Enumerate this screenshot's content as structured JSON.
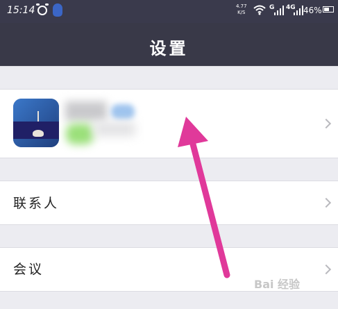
{
  "status_bar": {
    "time": "15:14",
    "net_speed": "4.77\nK/S",
    "battery": "46%",
    "signal_labels": [
      "G",
      "4G"
    ],
    "icons": [
      "alarm-icon",
      "qq-icon",
      "wifi-icon",
      "signal-icon",
      "battery-icon"
    ]
  },
  "header": {
    "title": "设置"
  },
  "profile": {
    "name": "",
    "account": ""
  },
  "menu": [
    {
      "label": "联系人"
    },
    {
      "label": "会议"
    }
  ],
  "watermark": "Bai 经验",
  "colors": {
    "header_bg": "#393948",
    "arrow": "#e0399a",
    "page_bg": "#f0eff4"
  }
}
